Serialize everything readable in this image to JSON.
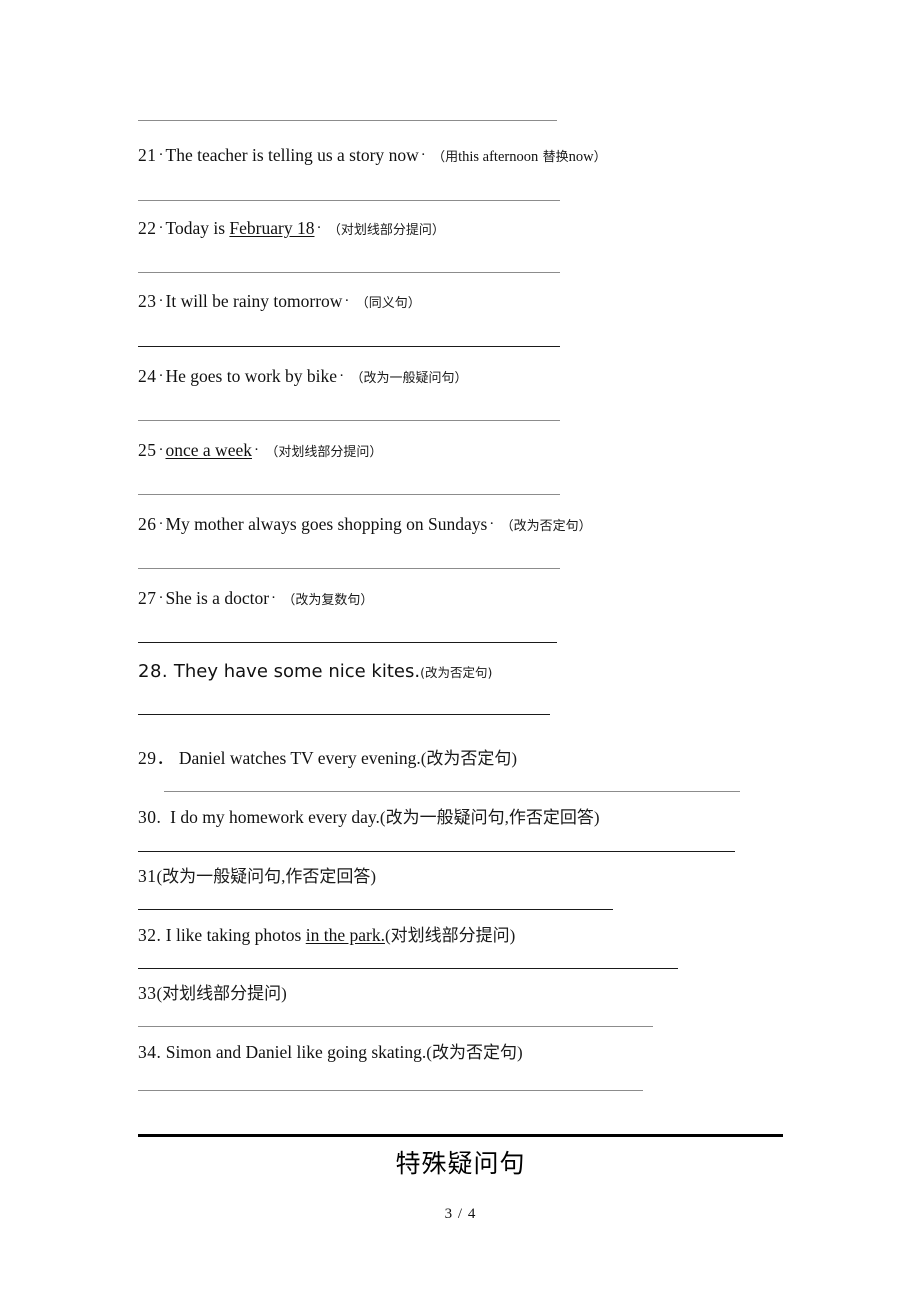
{
  "document": {
    "page_number_label": "3 / 4",
    "footer_heading": "特殊疑问句"
  },
  "questions": [
    {
      "number": "21",
      "separator": "·",
      "english": "The teacher is telling us a story",
      "english_tail": "now",
      "separator2": "·",
      "instruction": "（用 this afternoon 替换 now）",
      "instruction_pre": "（用",
      "instruction_mid": "this afternoon",
      "instruction_post": "替换",
      "instruction_tail": "now",
      "instruction_close": "）"
    },
    {
      "number": "22",
      "separator": "·",
      "english_pre": "Today is",
      "english_underlined": "February 18",
      "separator2": "·",
      "instruction": "（对划线部分提问）"
    },
    {
      "number": "23",
      "separator": "·",
      "english": "It will be rainy tomorrow",
      "separator2": "·",
      "instruction": "（同义句）"
    },
    {
      "number": "24",
      "separator": "·",
      "english": "He goes to work by bike",
      "separator2": "·",
      "instruction": "（改为一般疑问句）"
    },
    {
      "number": "25",
      "separator": "·",
      "english_underlined": "once a week",
      "separator2": "·",
      "instruction": "（对划线部分提问）"
    },
    {
      "number": "26",
      "separator": "·",
      "english": "My mother always goes shopping on Sundays",
      "separator2": "·",
      "instruction": "（改为否定句）"
    },
    {
      "number": "27",
      "separator": "·",
      "english": "She is a doctor",
      "separator2": "·",
      "instruction": "（改为复数句）"
    },
    {
      "number": "28.",
      "english": "They have some nice kites.",
      "instruction": "(改为否定句)"
    },
    {
      "number": "29．",
      "english": "Daniel watches TV every evening.",
      "instruction": "(改为否定句)"
    },
    {
      "number": "30.",
      "english": "I do my homework every day.",
      "instruction": "(改为一般疑问句,作否定回答)"
    },
    {
      "number": "31",
      "english": "",
      "instruction": "(改为一般疑问句,作否定回答)"
    },
    {
      "number": "32.",
      "english_pre": "I like taking photos",
      "english_underlined": "in the park.",
      "instruction": "(对划线部分提问)"
    },
    {
      "number": "33",
      "english": "",
      "instruction": "(对划线部分提问)"
    },
    {
      "number": "34.",
      "english": "Simon and Daniel like going skating.",
      "instruction": "(改为否定句)"
    }
  ]
}
